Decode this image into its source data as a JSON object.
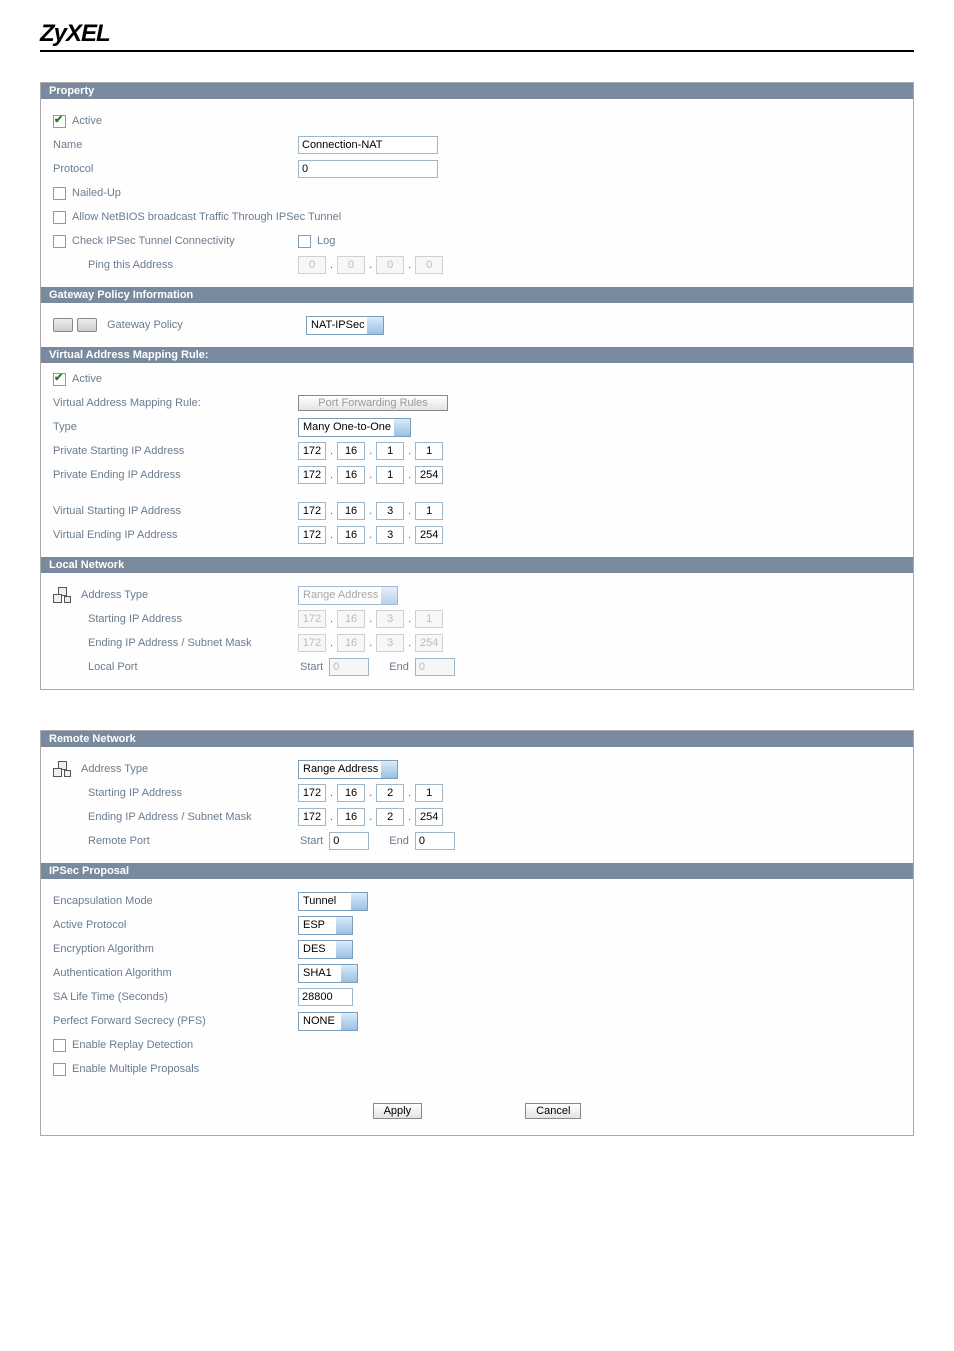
{
  "brand": "ZyXEL",
  "sections": {
    "property": {
      "title": "Property",
      "active_label": "Active",
      "active_checked": true,
      "name_label": "Name",
      "name_value": "Connection-NAT",
      "protocol_label": "Protocol",
      "protocol_value": "0",
      "nailed_up_label": "Nailed-Up",
      "nailed_up_checked": false,
      "allow_netbios_label": "Allow NetBIOS broadcast Traffic Through IPSec Tunnel",
      "allow_netbios_checked": false,
      "check_tunnel_label": "Check IPSec Tunnel Connectivity",
      "check_tunnel_checked": false,
      "log_label": "Log",
      "log_checked": false,
      "ping_label": "Ping this Address",
      "ping_ip": [
        "0",
        "0",
        "0",
        "0"
      ]
    },
    "gateway": {
      "title": "Gateway Policy Information",
      "label": "Gateway Policy",
      "value": "NAT-IPSec"
    },
    "vam": {
      "title": "Virtual Address Mapping Rule:",
      "active_label": "Active",
      "active_checked": true,
      "rule_label": "Virtual Address Mapping Rule:",
      "port_fwd_btn": "Port Forwarding Rules",
      "type_label": "Type",
      "type_value": "Many One-to-One",
      "priv_start_label": "Private Starting IP Address",
      "priv_start_ip": [
        "172",
        "16",
        "1",
        "1"
      ],
      "priv_end_label": "Private Ending IP Address",
      "priv_end_ip": [
        "172",
        "16",
        "1",
        "254"
      ],
      "virt_start_label": "Virtual Starting IP Address",
      "virt_start_ip": [
        "172",
        "16",
        "3",
        "1"
      ],
      "virt_end_label": "Virtual Ending IP Address",
      "virt_end_ip": [
        "172",
        "16",
        "3",
        "254"
      ]
    },
    "local": {
      "title": "Local Network",
      "addr_type_label": "Address Type",
      "addr_type_value": "Range Address",
      "start_label": "Starting IP Address",
      "start_ip": [
        "172",
        "16",
        "3",
        "1"
      ],
      "end_label": "Ending IP Address / Subnet Mask",
      "end_ip": [
        "172",
        "16",
        "3",
        "254"
      ],
      "port_label": "Local Port",
      "port_start_label": "Start",
      "port_start_value": "0",
      "port_end_label": "End",
      "port_end_value": "0"
    },
    "remote": {
      "title": "Remote Network",
      "addr_type_label": "Address Type",
      "addr_type_value": "Range Address",
      "start_label": "Starting IP Address",
      "start_ip": [
        "172",
        "16",
        "2",
        "1"
      ],
      "end_label": "Ending IP Address / Subnet Mask",
      "end_ip": [
        "172",
        "16",
        "2",
        "254"
      ],
      "port_label": "Remote Port",
      "port_start_label": "Start",
      "port_start_value": "0",
      "port_end_label": "End",
      "port_end_value": "0"
    },
    "proposal": {
      "title": "IPSec Proposal",
      "encap_label": "Encapsulation Mode",
      "encap_value": "Tunnel",
      "active_proto_label": "Active Protocol",
      "active_proto_value": "ESP",
      "enc_alg_label": "Encryption Algorithm",
      "enc_alg_value": "DES",
      "auth_alg_label": "Authentication Algorithm",
      "auth_alg_value": "SHA1",
      "sa_life_label": "SA Life Time (Seconds)",
      "sa_life_value": "28800",
      "pfs_label": "Perfect Forward Secrecy (PFS)",
      "pfs_value": "NONE",
      "replay_label": "Enable Replay Detection",
      "replay_checked": false,
      "multi_label": "Enable Multiple Proposals",
      "multi_checked": false
    }
  },
  "buttons": {
    "apply": "Apply",
    "cancel": "Cancel"
  }
}
